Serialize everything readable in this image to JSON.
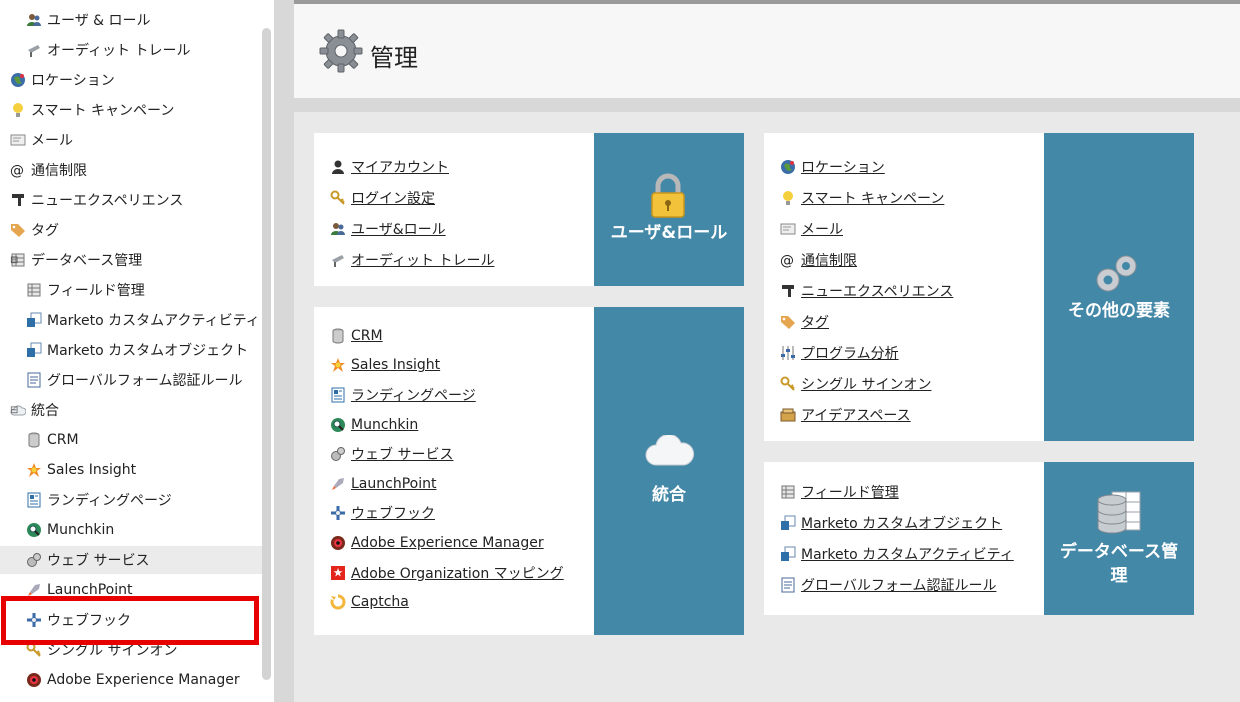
{
  "sidebar": {
    "items": [
      {
        "label": "ユーザ & ロール",
        "icon": "users-icon",
        "indent": 1
      },
      {
        "label": "オーディット トレール",
        "icon": "audit-trail-icon",
        "indent": 1
      },
      {
        "label": "ロケーション",
        "icon": "globe-icon",
        "indent": 0
      },
      {
        "label": "スマート キャンペーン",
        "icon": "lightbulb-icon",
        "indent": 0
      },
      {
        "label": "メール",
        "icon": "email-icon",
        "indent": 0
      },
      {
        "label": "通信制限",
        "icon": "at-sign-icon",
        "indent": 0
      },
      {
        "label": "ニューエクスペリエンス",
        "icon": "new-experience-icon",
        "indent": 0
      },
      {
        "label": "タグ",
        "icon": "tag-icon",
        "indent": 0
      },
      {
        "label": "データベース管理",
        "icon": "database-icon",
        "indent": 0,
        "collapsible": true
      },
      {
        "label": "フィールド管理",
        "icon": "field-management-icon",
        "indent": 1
      },
      {
        "label": "Marketo カスタムアクティビティ",
        "icon": "custom-activity-icon",
        "indent": 1
      },
      {
        "label": "Marketo カスタムオブジェクト",
        "icon": "custom-object-icon",
        "indent": 1
      },
      {
        "label": "グローバルフォーム認証ルール",
        "icon": "form-rule-icon",
        "indent": 1
      },
      {
        "label": "統合",
        "icon": "cloud-icon",
        "indent": 0,
        "collapsible": true
      },
      {
        "label": "CRM",
        "icon": "crm-icon",
        "indent": 1
      },
      {
        "label": "Sales Insight",
        "icon": "sales-insight-icon",
        "indent": 1
      },
      {
        "label": "ランディングページ",
        "icon": "landing-page-icon",
        "indent": 1
      },
      {
        "label": "Munchkin",
        "icon": "munchkin-icon",
        "indent": 1
      },
      {
        "label": "ウェブ サービス",
        "icon": "web-service-icon",
        "indent": 1,
        "hover": true
      },
      {
        "label": "LaunchPoint",
        "icon": "rocket-icon",
        "indent": 1
      },
      {
        "label": "ウェブフック",
        "icon": "webhook-icon",
        "indent": 1
      },
      {
        "label": "シングル サインオン",
        "icon": "key-icon",
        "indent": 1
      },
      {
        "label": "Adobe Experience Manager",
        "icon": "aem-icon",
        "indent": 1
      }
    ]
  },
  "header": {
    "title": "管理",
    "icon": "gear-icon"
  },
  "cards": {
    "users": {
      "tile_label": "ユーザ&ロール",
      "tile_icon": "padlock-icon",
      "links": [
        {
          "label": "マイアカウント",
          "icon": "person-icon"
        },
        {
          "label": "ログイン設定",
          "icon": "key-icon"
        },
        {
          "label": "ユーザ&ロール",
          "icon": "users-icon"
        },
        {
          "label": "オーディット トレール",
          "icon": "audit-trail-icon"
        }
      ]
    },
    "integration": {
      "tile_label": "統合",
      "tile_icon": "cloud-icon",
      "links": [
        {
          "label": "CRM",
          "icon": "crm-icon"
        },
        {
          "label": "Sales Insight",
          "icon": "sales-insight-icon"
        },
        {
          "label": "ランディングページ",
          "icon": "landing-page-icon"
        },
        {
          "label": "Munchkin",
          "icon": "munchkin-icon"
        },
        {
          "label": "ウェブ サービス",
          "icon": "web-service-icon"
        },
        {
          "label": "LaunchPoint",
          "icon": "rocket-icon"
        },
        {
          "label": "ウェブフック",
          "icon": "webhook-icon"
        },
        {
          "label": "Adobe Experience Manager",
          "icon": "aem-icon"
        },
        {
          "label": "Adobe Organization マッピング",
          "icon": "adobe-org-icon"
        },
        {
          "label": "Captcha",
          "icon": "captcha-icon"
        }
      ]
    },
    "other": {
      "tile_label": "その他の要素",
      "tile_icon": "gears-icon",
      "links": [
        {
          "label": "ロケーション",
          "icon": "globe-icon"
        },
        {
          "label": "スマート キャンペーン",
          "icon": "lightbulb-icon"
        },
        {
          "label": "メール",
          "icon": "email-icon"
        },
        {
          "label": "通信制限",
          "icon": "at-sign-icon"
        },
        {
          "label": "ニューエクスペリエンス",
          "icon": "new-experience-icon"
        },
        {
          "label": "タグ",
          "icon": "tag-icon"
        },
        {
          "label": "プログラム分析",
          "icon": "sliders-icon"
        },
        {
          "label": "シングル サインオン",
          "icon": "key-icon"
        },
        {
          "label": "アイデアスペース",
          "icon": "idea-space-icon"
        }
      ]
    },
    "database": {
      "tile_label": "データベース管理",
      "tile_icon": "database-table-icon",
      "links": [
        {
          "label": "フィールド管理",
          "icon": "field-management-icon"
        },
        {
          "label": "Marketo カスタムオブジェクト",
          "icon": "custom-object-icon"
        },
        {
          "label": "Marketo カスタムアクティビティ",
          "icon": "custom-activity-icon"
        },
        {
          "label": "グローバルフォーム認証ルール",
          "icon": "form-rule-icon"
        }
      ]
    }
  },
  "colors": {
    "tile": "#4488a8",
    "highlight": "#e60000"
  }
}
